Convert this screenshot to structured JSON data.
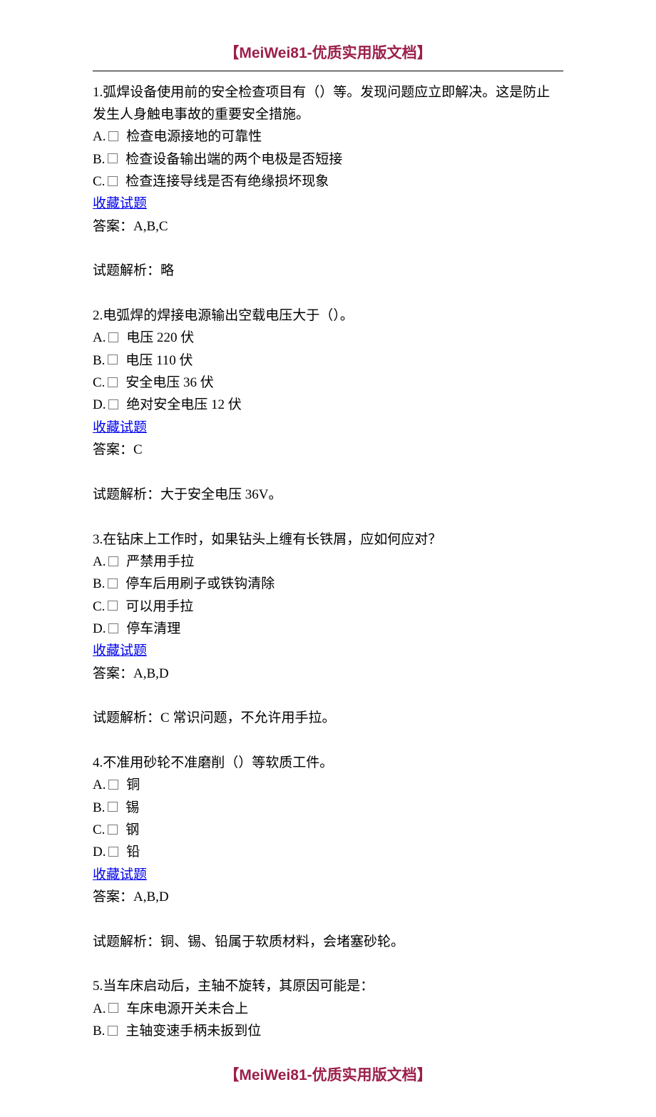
{
  "header": "【MeiWei81-优质实用版文档】",
  "footer": "【MeiWei81-优质实用版文档】",
  "fav_label": "收藏试题",
  "answer_prefix": "答案：",
  "analysis_prefix": "试题解析：",
  "questions": [
    {
      "stem": "1.弧焊设备使用前的安全检查项目有（）等。发现问题应立即解决。这是防止发生人身触电事故的重要安全措施。",
      "options": [
        {
          "letter": "A.",
          "text": "检查电源接地的可靠性"
        },
        {
          "letter": "B.",
          "text": "检查设备输出端的两个电极是否短接"
        },
        {
          "letter": "C.",
          "text": "检查连接导线是否有绝缘损坏现象"
        }
      ],
      "answer": "A,B,C",
      "analysis": "略"
    },
    {
      "stem": "2.电弧焊的焊接电源输出空载电压大于（）。",
      "options": [
        {
          "letter": "A.",
          "text": "电压 220 伏"
        },
        {
          "letter": "B.",
          "text": "电压 110 伏"
        },
        {
          "letter": "C.",
          "text": "安全电压 36 伏"
        },
        {
          "letter": "D.",
          "text": "绝对安全电压 12 伏"
        }
      ],
      "answer": "C",
      "analysis": "大于安全电压 36V。"
    },
    {
      "stem": "3.在钻床上工作时，如果钻头上缠有长铁屑，应如何应对？",
      "options": [
        {
          "letter": "A.",
          "text": "严禁用手拉"
        },
        {
          "letter": "B.",
          "text": "停车后用刷子或铁钩清除"
        },
        {
          "letter": "C.",
          "text": "可以用手拉"
        },
        {
          "letter": "D.",
          "text": "停车清理"
        }
      ],
      "answer": "A,B,D",
      "analysis": "C 常识问题，不允许用手拉。"
    },
    {
      "stem": "4.不准用砂轮不准磨削（）等软质工件。",
      "options": [
        {
          "letter": "A.",
          "text": "铜"
        },
        {
          "letter": "B.",
          "text": "锡"
        },
        {
          "letter": "C.",
          "text": "钢"
        },
        {
          "letter": "D.",
          "text": "铅"
        }
      ],
      "answer": "A,B,D",
      "analysis": "铜、锡、铅属于软质材料，会堵塞砂轮。"
    },
    {
      "stem": "5.当车床启动后，主轴不旋转，其原因可能是：",
      "options": [
        {
          "letter": "A.",
          "text": "车床电源开关未合上"
        },
        {
          "letter": "B.",
          "text": "主轴变速手柄未扳到位"
        }
      ],
      "partial": true
    }
  ]
}
